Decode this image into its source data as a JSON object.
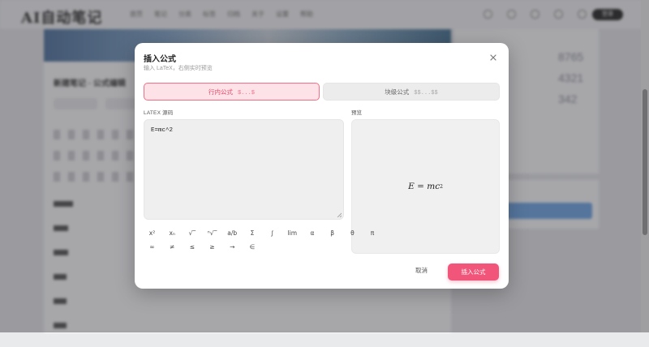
{
  "background": {
    "logo": "AI自动笔记",
    "nav_items": [
      "首页",
      "笔记",
      "分类",
      "标签",
      "归档",
      "关于",
      "设置",
      "帮助"
    ],
    "login": "登录",
    "editor_title": "新建笔记 · 公式编辑",
    "stats": [
      "8765",
      "4321",
      "342"
    ]
  },
  "modal": {
    "title": "插入公式",
    "subtitle": "输入 LaTeX，右侧实时预览",
    "modes": {
      "inline_label": "行内公式",
      "inline_hint": "$...$",
      "block_label": "块级公式",
      "block_hint": "$$...$$",
      "selected": "inline"
    },
    "source_label": "LATEX 源码",
    "source_value": "E=mc^2",
    "preview_label": "预览",
    "preview": {
      "lhs": "E",
      "eq": "=",
      "rhs": "mc",
      "exp": "2"
    },
    "symbols_row1": [
      "x²",
      "xₙ",
      "√‾",
      "ⁿ√‾",
      "a/b",
      "Σ",
      "∫",
      "lim",
      "α",
      "β",
      "θ",
      "π"
    ],
    "symbols_row2": [
      "∞",
      "≠",
      "≤",
      "≥",
      "→",
      "∈"
    ],
    "cancel_label": "取消",
    "insert_label": "插入公式"
  },
  "colors": {
    "accent": "#f2557a",
    "accent_light": "#fde3e8",
    "overlay": "#3c3c42"
  },
  "icons": {
    "close": "close-icon"
  }
}
